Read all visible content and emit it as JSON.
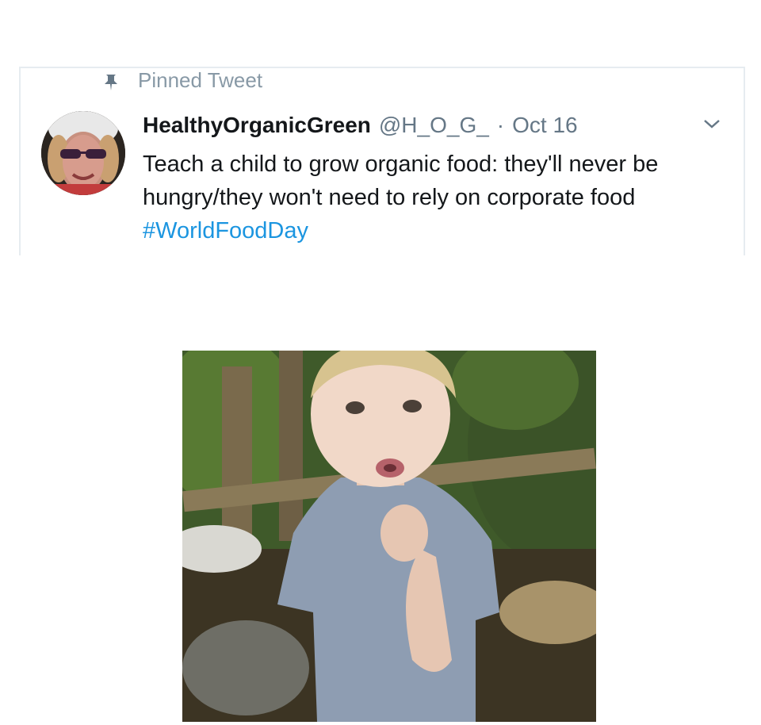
{
  "tweet": {
    "pinned_label": "Pinned Tweet",
    "display_name": "HealthyOrganicGreen",
    "handle": "@H_O_G_",
    "separator": "·",
    "timestamp": "Oct 16",
    "text": "Teach a child to grow organic food: they'll never be hungry/they won't  need to rely on corporate food ",
    "hashtag": "#WorldFoodDay",
    "icons": {
      "pin": "pin-icon",
      "menu": "chevron-down-icon",
      "avatar": "avatar"
    },
    "colors": {
      "hashtag": "#1b95e0",
      "meta": "#657786",
      "pinned": "#8899a6",
      "border": "#e6ecf0"
    }
  },
  "media": {
    "type": "photo",
    "subject": "child-in-garden-photo"
  }
}
